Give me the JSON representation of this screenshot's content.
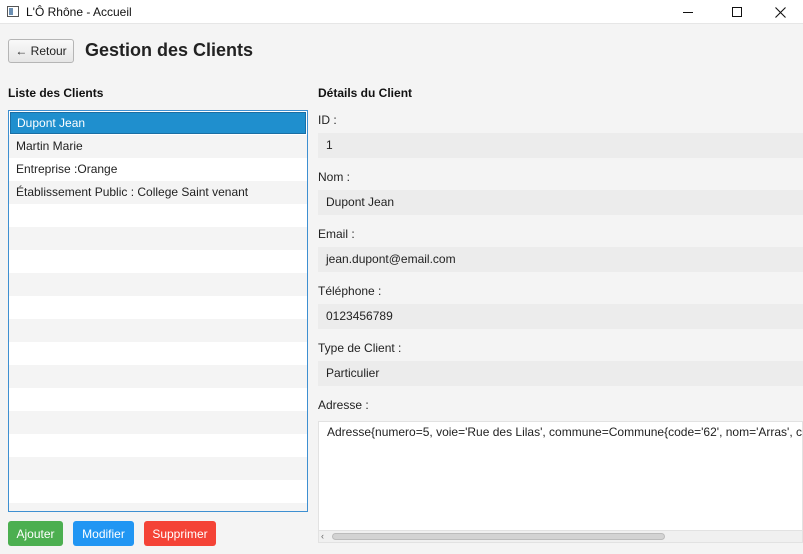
{
  "window": {
    "title": "L'Ô Rhône - Accueil",
    "icon": "app-window-icon",
    "controls": {
      "minimize_icon": "minimize-icon",
      "maximize_icon": "maximize-icon",
      "close_icon": "close-icon"
    }
  },
  "header": {
    "back_label": "← Retour",
    "title": "Gestion des Clients"
  },
  "list": {
    "label": "Liste des Clients",
    "items": [
      "Dupont Jean",
      "Martin Marie",
      "Entreprise :Orange",
      "Établissement Public : College Saint venant"
    ],
    "selected_index": 0
  },
  "actions": {
    "add": "Ajouter",
    "edit": "Modifier",
    "delete": "Supprimer",
    "colors": {
      "add": "#4caf50",
      "edit": "#2196f3",
      "delete": "#f44336"
    }
  },
  "details": {
    "label": "Détails du Client",
    "id_label": "ID :",
    "id_value": "1",
    "name_label": "Nom :",
    "name_value": "Dupont Jean",
    "email_label": "Email :",
    "email_value": "jean.dupont@email.com",
    "phone_label": "Téléphone :",
    "phone_value": "0123456789",
    "type_label": "Type de Client :",
    "type_value": "Particulier",
    "address_label": "Adresse :",
    "address_value": "Adresse{numero=5, voie='Rue des Lilas', commune=Commune{code='62', nom='Arras', c"
  }
}
